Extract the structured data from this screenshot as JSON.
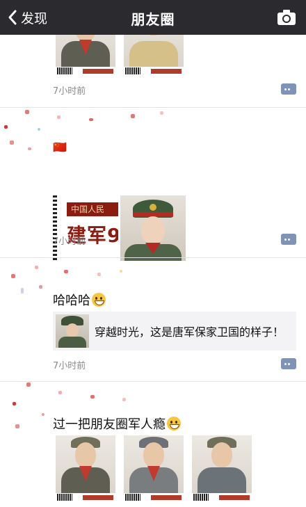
{
  "navbar": {
    "back_label": "发现",
    "title": "朋友圈",
    "back_icon": "chevron-left-icon",
    "camera_icon": "camera-icon"
  },
  "posts": [
    {
      "time": "7小时前",
      "images": [
        "portrait-red-collar",
        "portrait-beige-uniform"
      ]
    },
    {
      "text": "🇨🇳",
      "poster_line1": "中国人民",
      "poster_line2": "建军9(",
      "time": "7小时前"
    },
    {
      "text": "哈哈哈",
      "shared_link_title": "穿越时光，这是唐军保家卫国的样子！",
      "time": "7小时前"
    },
    {
      "text": "过一把朋友圈军人瘾",
      "images": [
        "portrait-red-collar",
        "portrait-smiling-soldier",
        "portrait-salute"
      ]
    }
  ],
  "colors": {
    "navbar": "#2b2b2f",
    "comment_icon": "#7f93b6",
    "time_text": "#8a8a8a",
    "shared_link_bg": "#f3f3f5"
  }
}
